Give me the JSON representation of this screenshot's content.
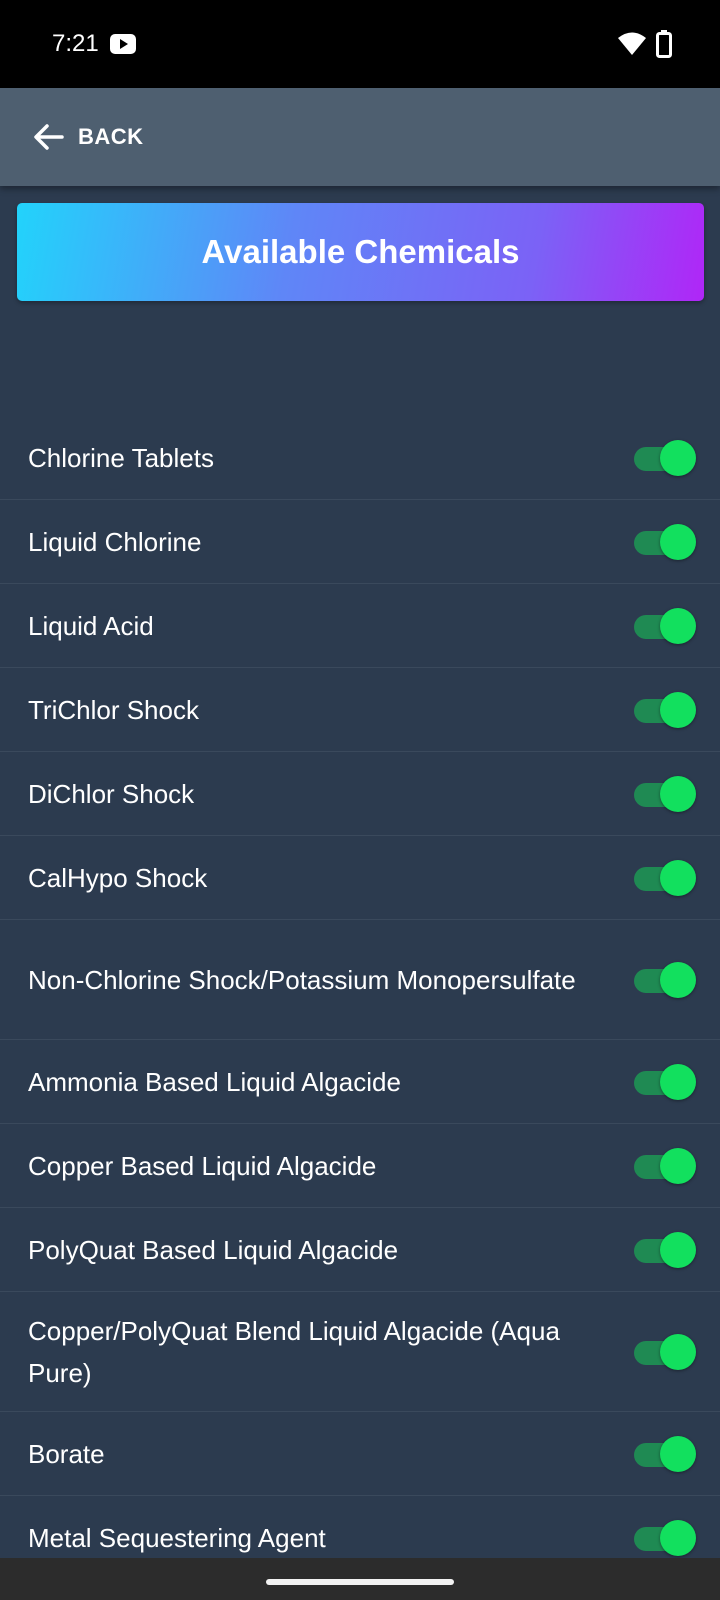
{
  "status_bar": {
    "time": "7:21"
  },
  "app_bar": {
    "back_label": "BACK"
  },
  "header": {
    "title": "Available Chemicals"
  },
  "chemicals": [
    {
      "label": "Chlorine Tablets",
      "enabled": true
    },
    {
      "label": "Liquid Chlorine",
      "enabled": true
    },
    {
      "label": "Liquid Acid",
      "enabled": true
    },
    {
      "label": "TriChlor Shock",
      "enabled": true
    },
    {
      "label": "DiChlor Shock",
      "enabled": true
    },
    {
      "label": "CalHypo Shock",
      "enabled": true
    },
    {
      "label": "Non-Chlorine Shock/Potassium Monopersulfate",
      "enabled": true
    },
    {
      "label": "Ammonia Based Liquid Algacide",
      "enabled": true
    },
    {
      "label": "Copper Based Liquid Algacide",
      "enabled": true
    },
    {
      "label": "PolyQuat Based Liquid Algacide",
      "enabled": true
    },
    {
      "label": "Copper/PolyQuat Blend Liquid Algacide (Aqua Pure)",
      "enabled": true
    },
    {
      "label": "Borate",
      "enabled": true
    },
    {
      "label": "Metal Sequestering Agent",
      "enabled": true
    }
  ],
  "colors": {
    "background": "#2c3b4f",
    "app_bar": "#4e5f70",
    "toggle_on_thumb": "#12e05e",
    "toggle_on_track": "#1f8a53",
    "banner_gradient_start": "#22d3fb",
    "banner_gradient_end": "#b026f7"
  }
}
